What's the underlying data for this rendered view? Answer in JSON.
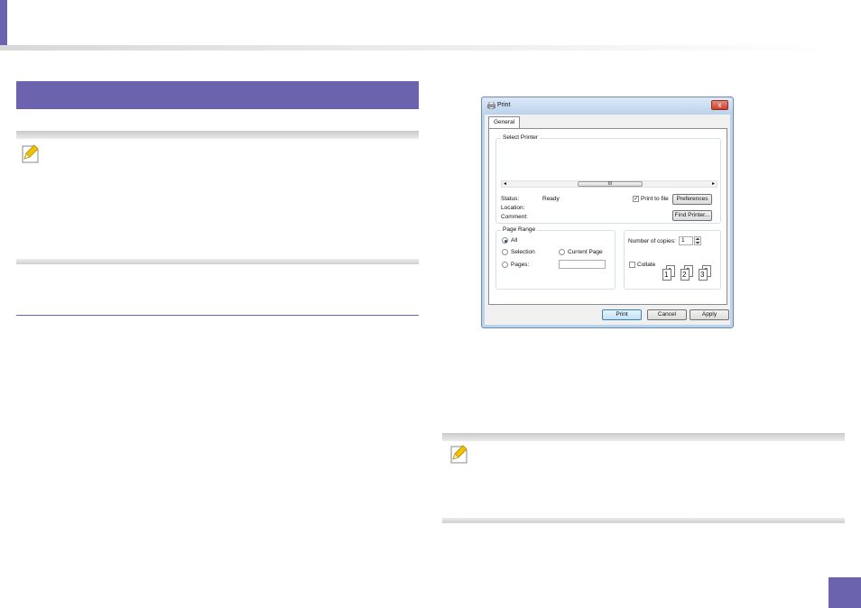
{
  "dialog": {
    "title": "Print",
    "close_glyph": "x",
    "tab_general": "General",
    "select_printer_label": "Select Printer",
    "scroll_left": "◂",
    "scroll_right": "▸",
    "scroll_thumb": "III",
    "status_label": "Status:",
    "status_value": "Ready",
    "location_label": "Location:",
    "comment_label": "Comment:",
    "print_to_file_label": "Print to file",
    "print_to_file_checked": true,
    "preferences_button": "Preferences",
    "find_printer_button": "Find Printer...",
    "page_range_label": "Page Range",
    "range_all": "All",
    "range_selection": "Selection",
    "range_current_page": "Current Page",
    "range_pages": "Pages:",
    "pages_value": "",
    "copies_label": "Number of copies:",
    "copies_value": "1",
    "collate_label": "Collate",
    "collate_checked": false,
    "collate_pages": [
      "1",
      "1",
      "2",
      "2",
      "3",
      "3"
    ],
    "print_button": "Print",
    "cancel_button": "Cancel",
    "apply_button": "Apply"
  },
  "colors": {
    "accent": "#6b63ad",
    "dialog_frame": "#bcd3ec",
    "close_button": "#c8402b"
  },
  "icons": {
    "note": "note-pencil-icon",
    "printer": "printer-icon"
  }
}
